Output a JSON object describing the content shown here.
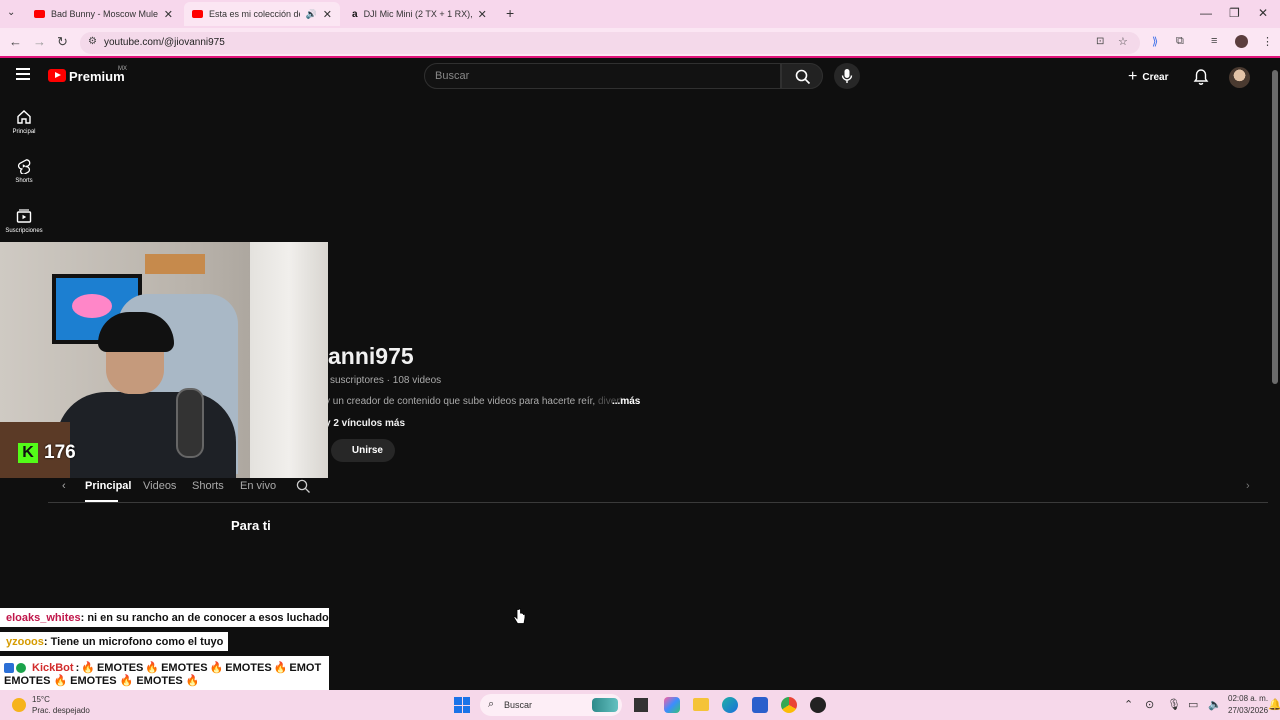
{
  "browser": {
    "tabs": [
      {
        "title": "Bad Bunny - Moscow Mule (Offi",
        "favicon": "youtube-icon"
      },
      {
        "title": "Esta es mi colección de Ma",
        "favicon": "youtube-icon",
        "active": true
      },
      {
        "title": "DJI Mic Mini (2 TX + 1 RX), mic",
        "favicon": "amazon-icon"
      }
    ],
    "url": "youtube.com/@jiovanni975"
  },
  "youtube": {
    "brand": "Premium",
    "region": "MX",
    "search_placeholder": "Buscar",
    "create_label": "Crear",
    "sidebar": [
      {
        "label": "Principal",
        "icon": "home-icon"
      },
      {
        "label": "Shorts",
        "icon": "shorts-icon"
      },
      {
        "label": "Suscripciones",
        "icon": "subscriptions-icon"
      }
    ]
  },
  "channel": {
    "name": "anni975",
    "stats": " suscriptores · 108 videos",
    "desc": "y un creador de contenido que sube videos para hacerte reír, ",
    "desc_fade": "divert",
    "more": "...más",
    "links": "y 2 vínculos más",
    "join": "Unirse",
    "tabs": [
      "Principal",
      "Videos",
      "Shorts",
      "En vivo"
    ],
    "section": "Para ti"
  },
  "stream": {
    "viewers": "176"
  },
  "chat": [
    {
      "user": "eloaks_whites",
      "text": " : ni en su rancho an de conocer a esos luchadores"
    },
    {
      "user": "yzooos",
      "text": " : Tiene un microfono como el tuyo"
    },
    {
      "user": "KickBot",
      "line1": " EMOTES ",
      "line2": "EMOTES ",
      "emote": "EMOTES",
      "cut": "EMOT"
    }
  ],
  "taskbar": {
    "temp": "15°C",
    "weather": "Prac. despejado",
    "search": "Buscar",
    "time": "02:08 a. m.",
    "date": "27/03/2026"
  }
}
